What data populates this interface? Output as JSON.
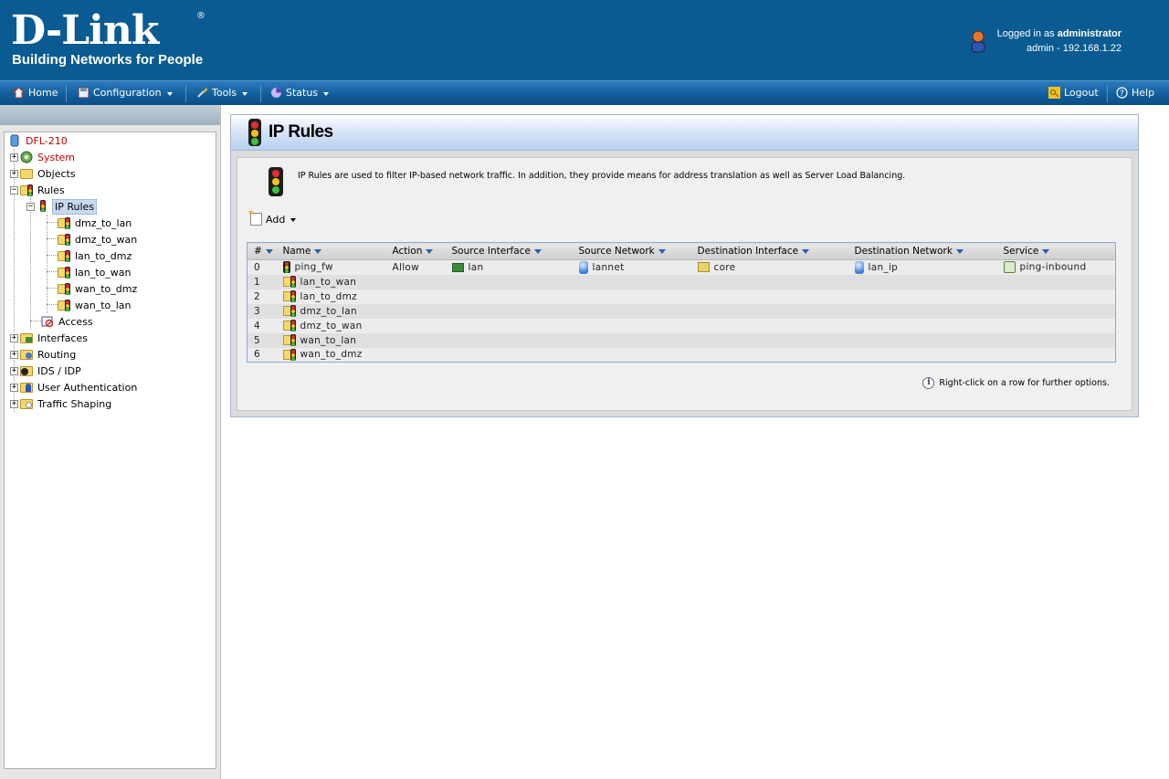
{
  "header": {
    "brand": "D-Link",
    "registered": "®",
    "tagline": "Building Networks for People",
    "logged_in_prefix": "Logged in as ",
    "logged_in_user": "administrator",
    "session": "admin - 192.168.1.22"
  },
  "menu": {
    "home": "Home",
    "configuration": "Configuration",
    "tools": "Tools",
    "status": "Status",
    "logout": "Logout",
    "help": "Help"
  },
  "tree": {
    "root": "DFL-210",
    "system": "System",
    "objects": "Objects",
    "rules": "Rules",
    "ip_rules": "IP Rules",
    "children": [
      "dmz_to_lan",
      "dmz_to_wan",
      "lan_to_dmz",
      "lan_to_wan",
      "wan_to_dmz",
      "wan_to_lan"
    ],
    "access": "Access",
    "interfaces": "Interfaces",
    "routing": "Routing",
    "ids_idp": "IDS / IDP",
    "user_auth": "User Authentication",
    "traffic_shaping": "Traffic Shaping"
  },
  "page": {
    "title": "IP Rules",
    "description": "IP Rules are used to filter IP-based network traffic. In addition, they provide means for address translation as well as Server Load Balancing.",
    "add_label": "Add",
    "hint": "Right-click on a row for further options."
  },
  "table": {
    "columns": [
      "#",
      "Name",
      "Action",
      "Source Interface",
      "Source Network",
      "Destination Interface",
      "Destination Network",
      "Service"
    ],
    "rows": [
      {
        "num": "0",
        "name": "ping_fw",
        "action": "Allow",
        "src_if": "lan",
        "src_net": "lannet",
        "dst_if": "core",
        "dst_net": "lan_ip",
        "service": "ping-inbound"
      },
      {
        "num": "1",
        "name": "lan_to_wan"
      },
      {
        "num": "2",
        "name": "lan_to_dmz"
      },
      {
        "num": "3",
        "name": "dmz_to_lan"
      },
      {
        "num": "4",
        "name": "dmz_to_wan"
      },
      {
        "num": "5",
        "name": "wan_to_lan"
      },
      {
        "num": "6",
        "name": "wan_to_dmz"
      }
    ]
  },
  "colors": {
    "header_bg": "#0a5b92",
    "menubar": "#125e9c",
    "selected_tree": "#c9d9ef",
    "system_label": "#c00000"
  }
}
